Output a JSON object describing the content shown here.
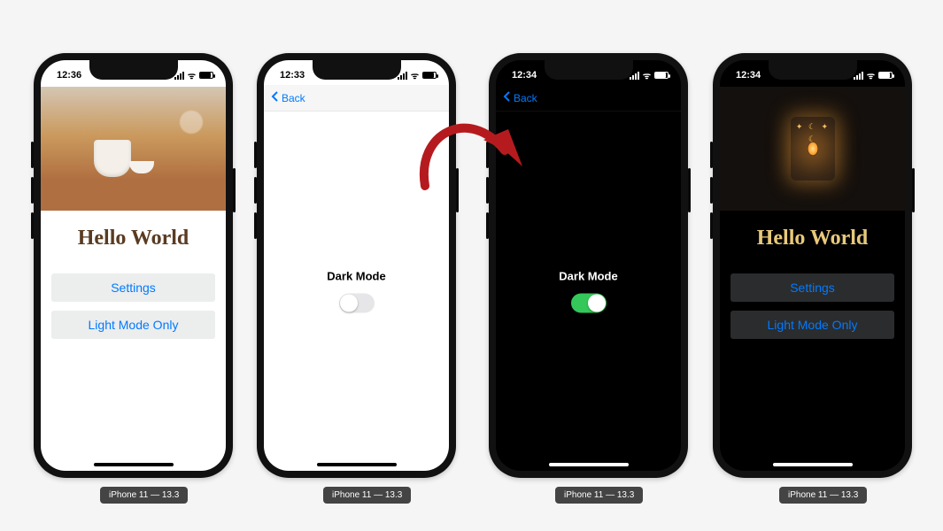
{
  "device_label": "iPhone 11 — 13.3",
  "screens": [
    {
      "time": "12:36",
      "mode": "light",
      "title": "Hello World",
      "buttons": {
        "settings": "Settings",
        "light_only": "Light Mode Only"
      }
    },
    {
      "time": "12:33",
      "mode": "light",
      "back_label": "Back",
      "toggle_label": "Dark Mode",
      "toggle_on": false
    },
    {
      "time": "12:34",
      "mode": "dark",
      "back_label": "Back",
      "toggle_label": "Dark Mode",
      "toggle_on": true
    },
    {
      "time": "12:34",
      "mode": "dark",
      "title": "Hello World",
      "buttons": {
        "settings": "Settings",
        "light_only": "Light Mode Only"
      }
    }
  ],
  "colors": {
    "ios_blue": "#007aff",
    "switch_on": "#34c759",
    "title_light": "#5a3b22",
    "title_dark": "#e8c97a",
    "arrow": "#b51b1e"
  }
}
